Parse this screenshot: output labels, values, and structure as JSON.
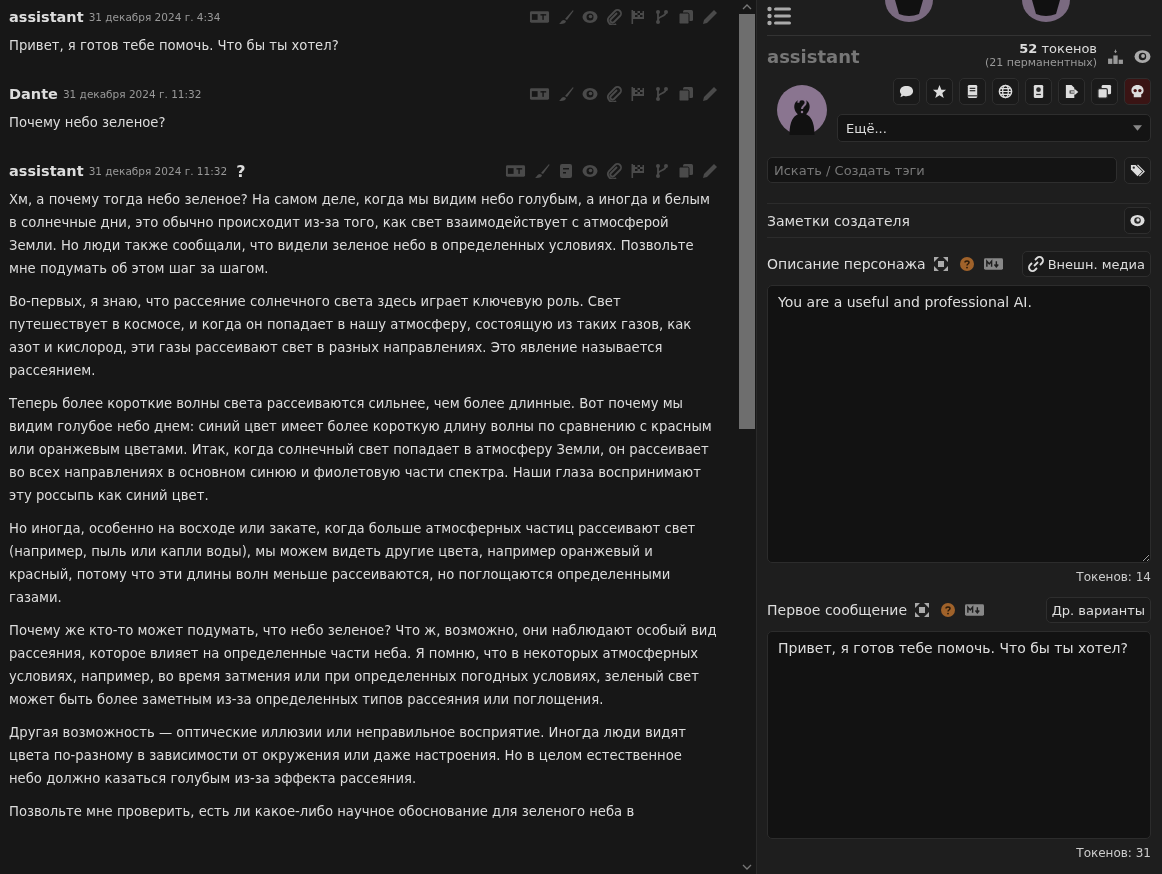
{
  "chat": {
    "messages": [
      {
        "name": "assistant",
        "date": "31 декабря 2024 г. 4:34",
        "prompt_icon": false,
        "paragraphs": [
          "Привет, я готов тебе помочь. Что бы ты хотел?"
        ]
      },
      {
        "name": "Dante",
        "date": "31 декабря 2024 г. 11:32",
        "prompt_icon": false,
        "paragraphs": [
          "Почему небо зеленое?"
        ]
      },
      {
        "name": "assistant",
        "date": "31 декабря 2024 г. 11:32",
        "question_mark": "?",
        "prompt_icon": true,
        "paragraphs": [
          "Хм, а почему тогда небо зеленое? На самом деле, когда мы видим небо голубым, а иногда и белым в солнечные дни, это обычно происходит из-за того, как свет взаимодействует с атмосферой Земли. Но люди также сообщали, что видели зеленое небо в определенных условиях. Позвольте мне подумать об этом шаг за шагом.",
          "Во-первых, я знаю, что рассеяние солнечного света здесь играет ключевую роль. Свет путешествует в космосе, и когда он попадает в нашу атмосферу, состоящую из таких газов, как азот и кислород, эти газы рассеивают свет в разных направлениях. Это явление называется рассеянием.",
          "Теперь более короткие волны света рассеиваются сильнее, чем более длинные. Вот почему мы видим голубое небо днем: синий цвет имеет более короткую длину волны по сравнению с красным или оранжевым цветами. Итак, когда солнечный свет попадает в атмосферу Земли, он рассеивает во всех направлениях в основном синюю и фиолетовую части спектра. Наши глаза воспринимают эту россыпь как синий цвет.",
          "Но иногда, особенно на восходе или закате, когда больше атмосферных частиц рассеивают свет (например, пыль или капли воды), мы можем видеть другие цвета, например оранжевый и красный, потому что эти длины волн меньше рассеиваются, но поглощаются определенными газами.",
          "Почему же кто-то может подумать, что небо зеленое? Что ж, возможно, они наблюдают особый вид рассеяния, которое влияет на определенные части неба. Я помню, что в некоторых атмосферных условиях, например, во время затмения или при определенных погодных условиях, зеленый свет может быть более заметным из-за определенных типов рассеяния или поглощения.",
          "Другая возможность — оптические иллюзии или неправильное восприятие. Иногда люди видят цвета по-разному в зависимости от окружения или даже настроения. Но в целом естественное небо должно казаться голубым из-за эффекта рассеяния.",
          "Позвольте мне проверить, есть ли какое-либо научное обоснование для зеленого неба в"
        ]
      }
    ]
  },
  "character": {
    "name": "assistant",
    "tokens": "**52** токенов",
    "permanent": "(21 перманентных)",
    "more_select": "Ещё...",
    "tag_search": {
      "placeholder": "Искать / Создать тэги"
    },
    "creator_notes": "Заметки создателя",
    "description": {
      "label": "Описание персонажа",
      "media_button": "Внешн. медиа",
      "value": "You are a useful and professional AI.",
      "token_count": "Токенов: 14"
    },
    "first_message": {
      "label": "Первое сообщение",
      "alt_button": "Др. варианты",
      "value": "Привет, я готов тебе помочь. Что бы ты хотел?",
      "token_count": "Токенов: 31"
    }
  }
}
